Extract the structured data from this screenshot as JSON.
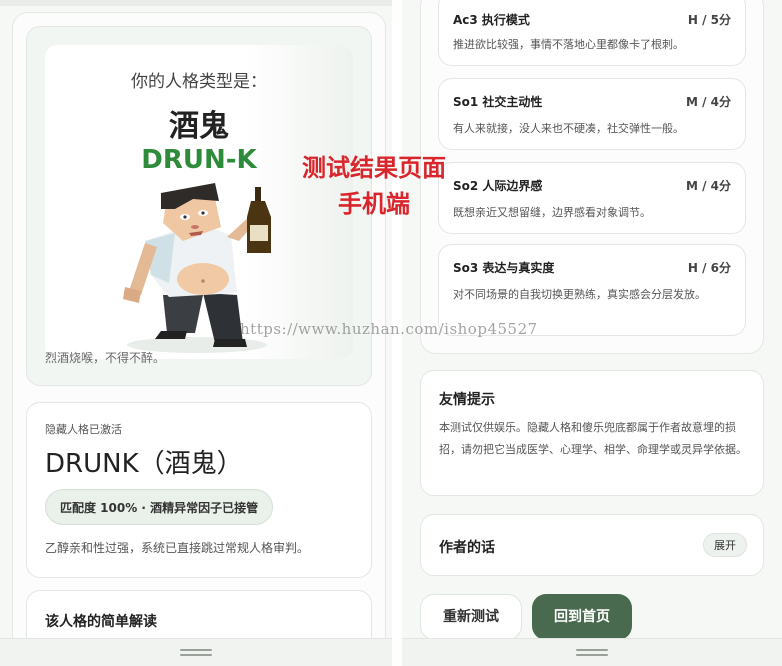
{
  "left": {
    "result": {
      "prompt": "你的人格类型是：",
      "type_name": "酒鬼",
      "type_code": "DRUN-K",
      "caption": "烈酒烧喉，不得不醉。"
    },
    "hidden": {
      "label": "隐藏人格已激活",
      "title": "DRUNK（酒鬼）",
      "badge": "匹配度 100% · 酒精异常因子已接管",
      "desc": "乙醇亲和性过强，系统已直接跳过常规人格审判。"
    },
    "brief": {
      "title": "该人格的简单解读"
    }
  },
  "right": {
    "dimensions": [
      {
        "name": "Ac3 执行模式",
        "score": "H / 5分",
        "desc": "推进欲比较强，事情不落地心里都像卡了根刺。"
      },
      {
        "name": "So1 社交主动性",
        "score": "M / 4分",
        "desc": "有人来就接，没人来也不硬凑，社交弹性一般。"
      },
      {
        "name": "So2 人际边界感",
        "score": "M / 4分",
        "desc": "既想亲近又想留缝，边界感看对象调节。"
      },
      {
        "name": "So3 表达与真实度",
        "score": "H / 6分",
        "desc": "对不同场景的自我切换更熟练，真实感会分层发放。"
      }
    ],
    "tips": {
      "title": "友情提示",
      "body": "本测试仅供娱乐。隐藏人格和傻乐兜底都属于作者故意埋的损招，请勿把它当成医学、心理学、相学、命理学或灵异学依据。"
    },
    "author": {
      "title": "作者的话",
      "expand_label": "展开"
    },
    "buttons": {
      "retest_label": "重新测试",
      "home_label": "回到首页"
    }
  },
  "overlay": {
    "title_line1": "测试结果页面",
    "title_line2": "手机端",
    "watermark": "https://www.huzhan.com/ishop45527"
  },
  "colors": {
    "accent_green": "#2e8b3a",
    "primary_button": "#4a6a4f",
    "overlay_red": "#d9262c"
  }
}
